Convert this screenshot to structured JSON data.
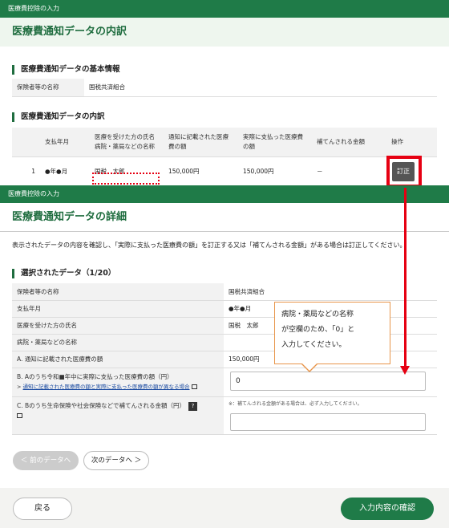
{
  "screen1": {
    "topbar": "医療費控除の入力",
    "title": "医療費通知データの内訳",
    "basic_section": {
      "heading": "医療費通知データの基本情報",
      "label": "保険者等の名称",
      "value": "国税共済組合"
    },
    "breakdown_section": {
      "heading": "医療費通知データの内訳",
      "columns": [
        "支払年月",
        "医療を受けた方の氏名\n病院・薬局などの名称",
        "通知に記載された医療\n費の額",
        "実際に支払った医療費\nの額",
        "補てんされる金額",
        "操作"
      ],
      "row": {
        "no": "1",
        "date": "●年●月",
        "name": "国税　太郎",
        "notice_amount": "150,000円",
        "paid_amount": "150,000円",
        "compensation": "－",
        "action": "訂正"
      }
    }
  },
  "screen2": {
    "topbar": "医療費控除の入力",
    "title": "医療費通知データの詳細",
    "description": "表示されたデータの内容を確認し、「実際に支払った医療費の額」を訂正する又は「補てんされる金額」がある場合は訂正してください。",
    "selected_heading": "選択されたデータ（1/20）",
    "rows": {
      "insurer": {
        "label": "保険者等の名称",
        "value": "国税共済組合"
      },
      "date": {
        "label": "支払年月",
        "value": "●年●月"
      },
      "patient": {
        "label": "医療を受けた方の氏名",
        "value": "国税　太郎"
      },
      "hospital": {
        "label": "病院・薬局などの名称",
        "value": ""
      },
      "notice": {
        "label": "A. 通知に記載された医療費の額",
        "value": "150,000円"
      },
      "paid": {
        "label": "B. Aのうち令和■年中に実際に支払った医療費の額（円）",
        "link": "通知に記載された医療費の額と実際に支払った医療費の額が異なる場合",
        "value": "0"
      },
      "compensation": {
        "label": "C. Bのうち生命保険や社会保険などで補てんされる金額（円）",
        "note": "※：補てんされる金額がある場合は、必ず入力してください。",
        "value": ""
      }
    },
    "prev_button": "＜ 前のデータへ",
    "next_button": "次のデータへ ＞",
    "back_button": "戻る",
    "confirm_button": "入力内容の確認"
  },
  "callout_text": "病院・薬局などの名称\nが空欄のため、「0」と\n入力してください。",
  "colors": {
    "header_green": "#1f7b48",
    "title_bg": "#eef6ee",
    "highlight_red": "#e60012",
    "callout_border": "#e8954a"
  }
}
